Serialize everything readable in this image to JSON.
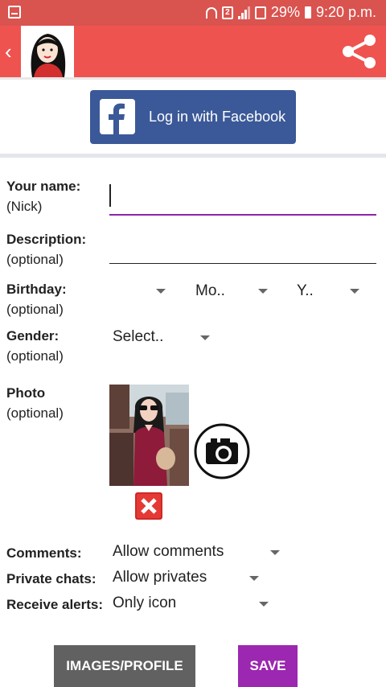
{
  "status_bar": {
    "battery": "29%",
    "time": "9:20 p.m.",
    "sim_label": "2",
    "icons": [
      "notification-icon",
      "wifi-icon",
      "sim-icon",
      "signal-icon",
      "battery-icon"
    ]
  },
  "app_bar": {
    "back_icon": "chevron-left-icon",
    "share_icon": "share-icon",
    "color": "#ef5350"
  },
  "facebook": {
    "label": "Log in with Facebook",
    "color": "#3b5998"
  },
  "form": {
    "name": {
      "label": "Your name:",
      "hint": "(Nick)",
      "value": ""
    },
    "description": {
      "label": "Description:",
      "hint": "(optional)",
      "value": ""
    },
    "birthday": {
      "label": "Birthday:",
      "hint": "(optional)",
      "day": "",
      "month": "Mo..",
      "year": "Y.."
    },
    "gender": {
      "label": "Gender:",
      "hint": "(optional)",
      "value": "Select.."
    },
    "photo": {
      "label": "Photo",
      "hint": "(optional)"
    },
    "comments": {
      "label": "Comments:",
      "value": "Allow comments"
    },
    "private_chats": {
      "label": "Private chats:",
      "value": "Allow privates"
    },
    "receive_alerts": {
      "label": "Receive alerts:",
      "value": "Only icon"
    }
  },
  "buttons": {
    "images_profile": "IMAGES/PROFILE",
    "save": "SAVE"
  },
  "colors": {
    "accent": "#9c27b0",
    "secondary_button": "#616161"
  }
}
